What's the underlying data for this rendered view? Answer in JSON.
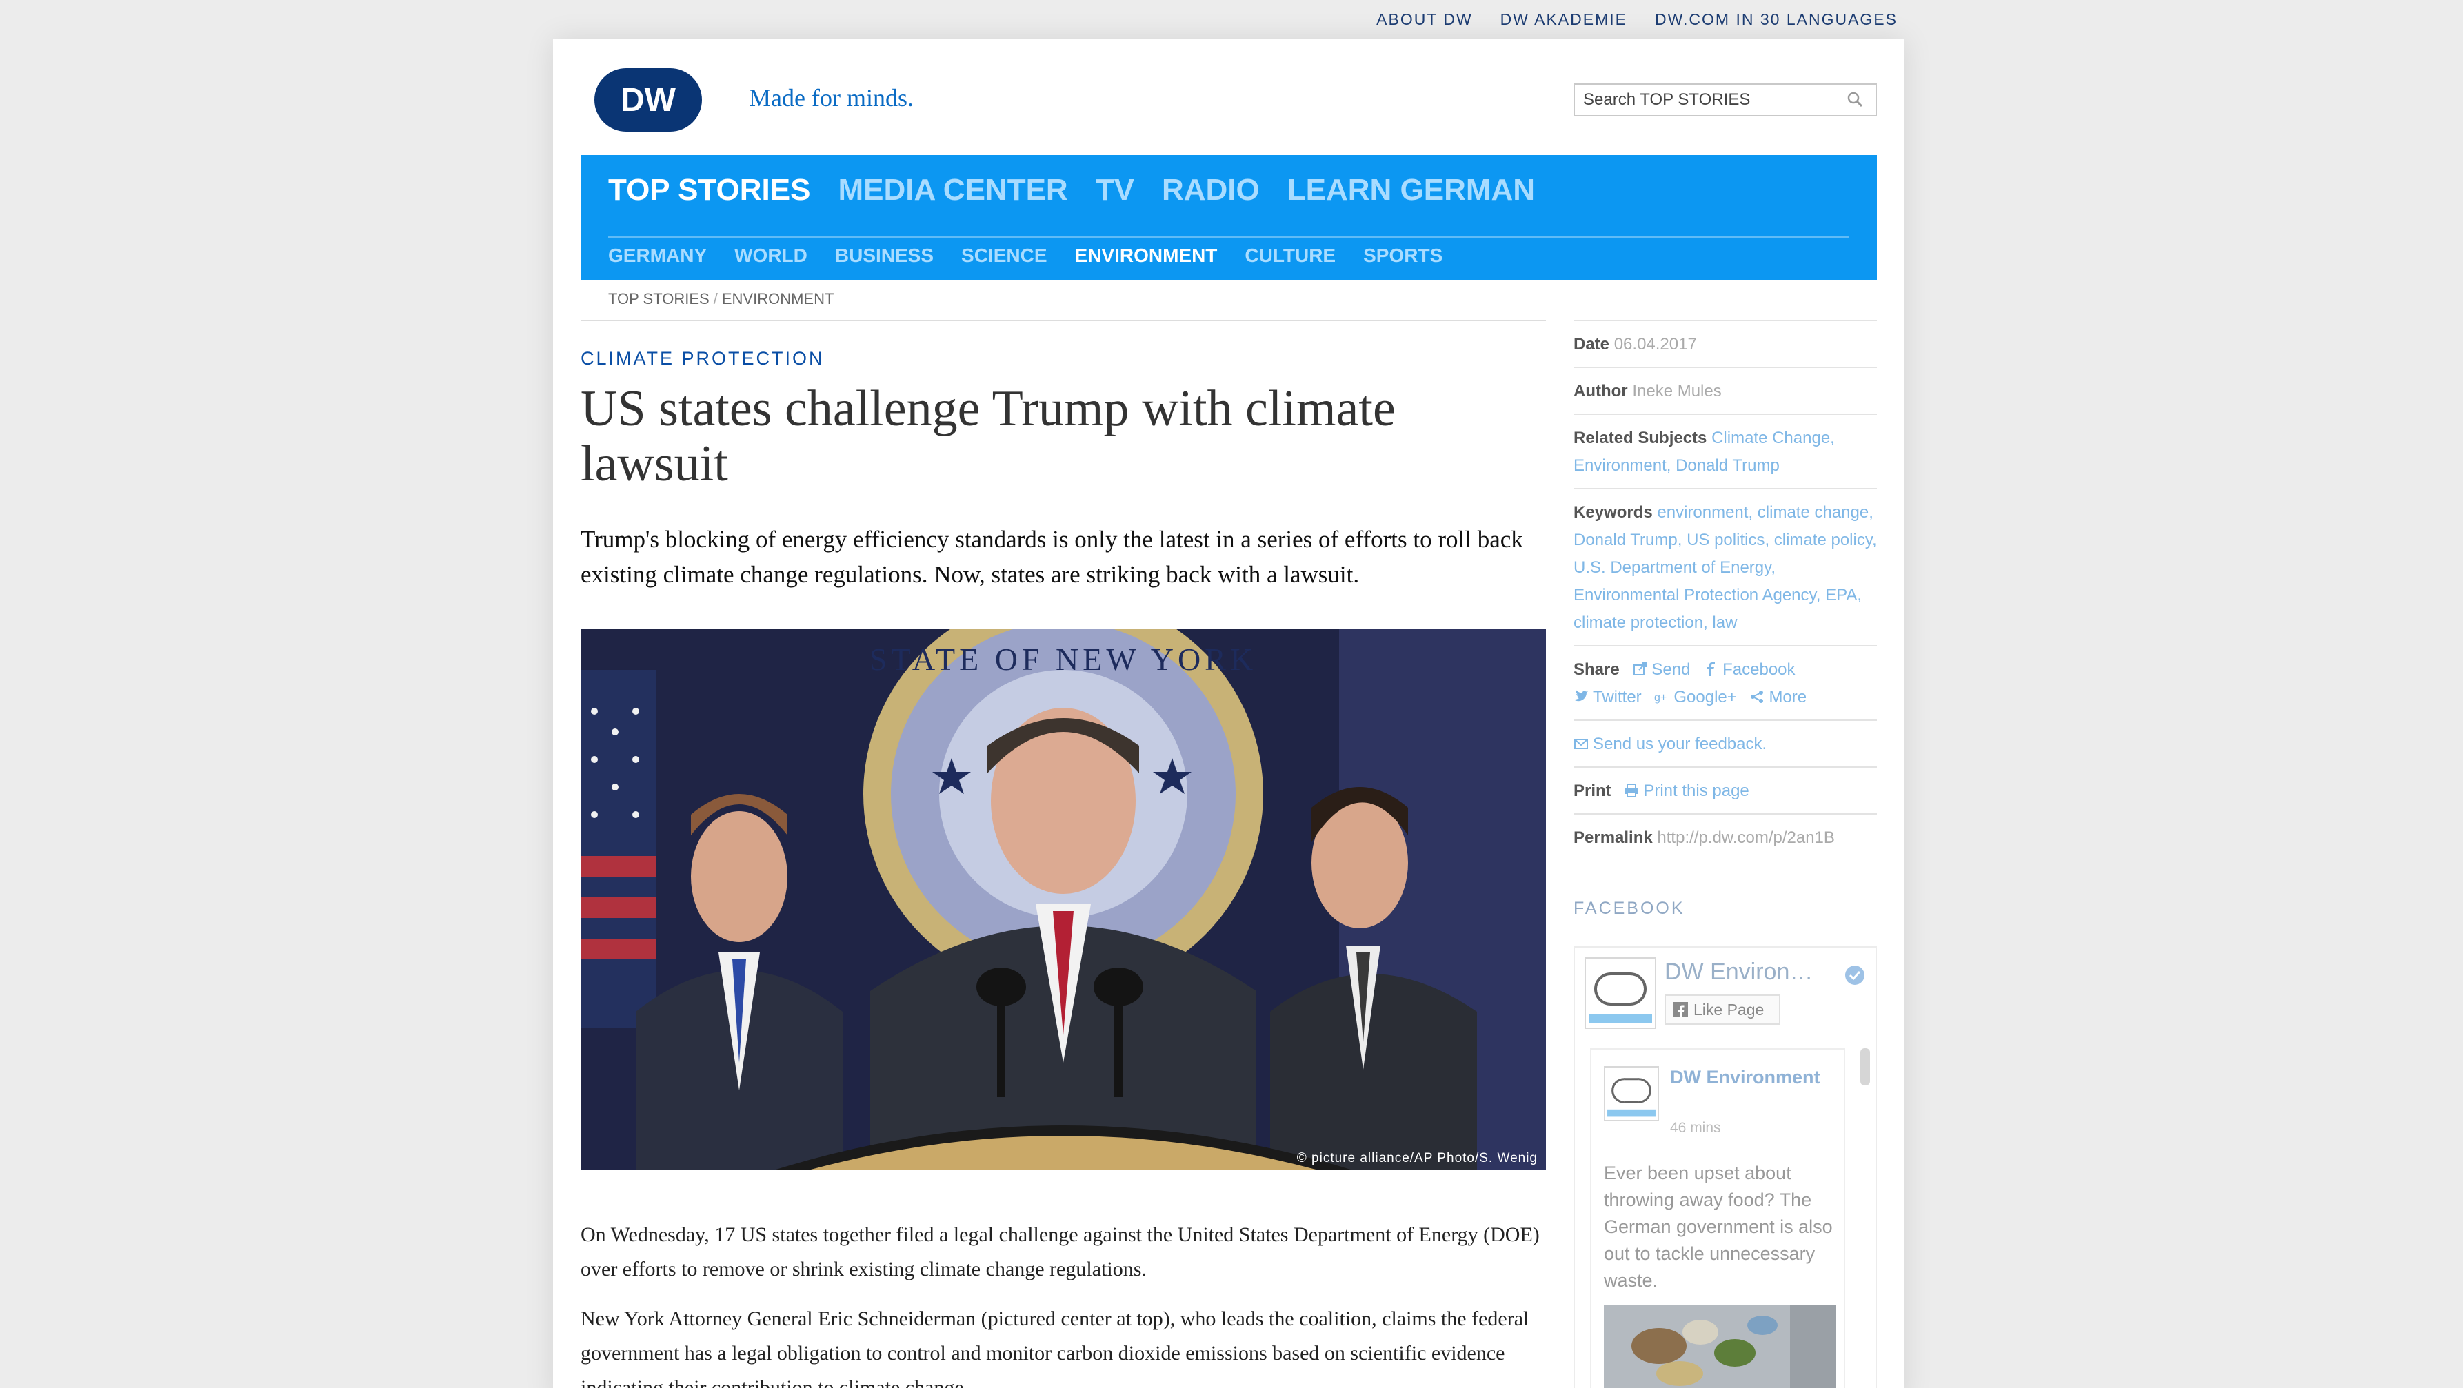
{
  "topbar": {
    "links": [
      "ABOUT DW",
      "DW AKADEMIE",
      "DW.COM IN 30 LANGUAGES"
    ]
  },
  "brand": {
    "logo_text": "DW",
    "tagline": "Made for minds.",
    "accent": "#0c97f2",
    "dark_blue": "#0a3574"
  },
  "search": {
    "placeholder": "Search TOP STORIES"
  },
  "nav": {
    "main": [
      "TOP STORIES",
      "MEDIA CENTER",
      "TV",
      "RADIO",
      "LEARN GERMAN"
    ],
    "main_active": "TOP STORIES",
    "sub": [
      "GERMANY",
      "WORLD",
      "BUSINESS",
      "SCIENCE",
      "ENVIRONMENT",
      "CULTURE",
      "SPORTS"
    ],
    "sub_active": "ENVIRONMENT"
  },
  "breadcrumb": {
    "items": [
      "TOP STORIES",
      "ENVIRONMENT"
    ]
  },
  "article": {
    "kicker": "CLIMATE PROTECTION",
    "headline": "US states challenge Trump with climate lawsuit",
    "lead": "Trump's blocking of energy efficiency standards is only the latest in a series of efforts to roll back existing climate change regulations. Now, states are striking back with a lawsuit.",
    "photo_credit": "© picture alliance/AP Photo/S. Wenig",
    "paragraphs": [
      "On Wednesday, 17 US states together filed a legal challenge against the United States Department of Energy (DOE) over efforts to remove or shrink existing climate change regulations.",
      "New York Attorney General Eric Schneiderman (pictured center at top), who leads the coalition, claims the federal government has a legal obligation to control and monitor carbon dioxide emissions based on scientific evidence indicating their contribution to climate change."
    ]
  },
  "sidebar": {
    "date_label": "Date",
    "date_value": "06.04.2017",
    "author_label": "Author",
    "author_value": "Ineke Mules",
    "related_label": "Related Subjects",
    "related_value": "Climate Change, Environment, Donald Trump",
    "keywords_label": "Keywords",
    "keywords_value": "environment, climate change, Donald Trump, US politics, climate policy, U.S. Department of Energy, Environmental Protection Agency, EPA, climate protection, law",
    "share_label": "Share",
    "share_send": "Send",
    "share_facebook": "Facebook",
    "share_twitter": "Twitter",
    "share_google": "Google+",
    "share_more": "More",
    "feedback": "Send us your feedback.",
    "print_label": "Print",
    "print_link": "Print this page",
    "permalink_label": "Permalink",
    "permalink_value": "http://p.dw.com/p/2an1B",
    "facebook_heading": "FACEBOOK",
    "fb_page_name": "DW Environ…",
    "fb_like": "Like Page",
    "fb_post_name": "DW Environment",
    "fb_post_time": "46 mins",
    "fb_post_text": "Ever been upset about throwing away food? The German government is also out to tackle unnecessary waste."
  }
}
